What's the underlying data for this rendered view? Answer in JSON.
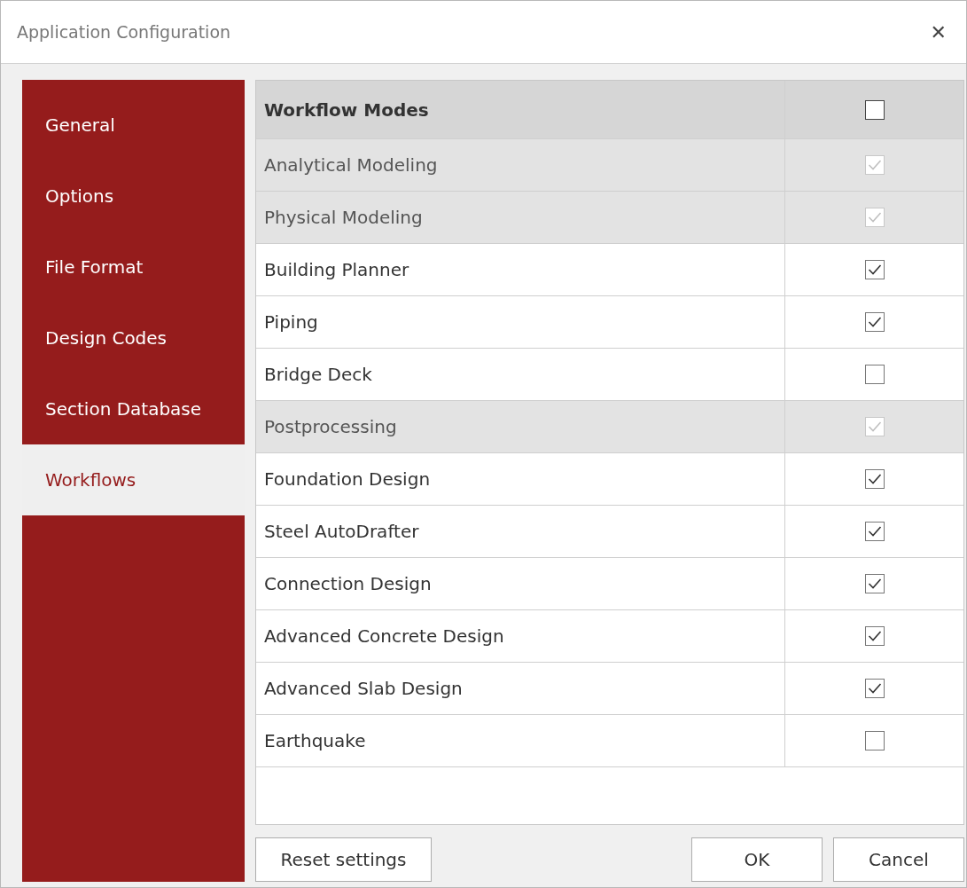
{
  "window": {
    "title": "Application Configuration",
    "close": "✕"
  },
  "sidebar": {
    "items": [
      {
        "label": "General",
        "selected": false
      },
      {
        "label": "Options",
        "selected": false
      },
      {
        "label": "File Format",
        "selected": false
      },
      {
        "label": "Design Codes",
        "selected": false
      },
      {
        "label": "Section Database",
        "selected": false
      },
      {
        "label": "Workflows",
        "selected": true
      }
    ]
  },
  "table": {
    "header": {
      "label": "Workflow Modes",
      "checked": false
    },
    "rows": [
      {
        "label": "Analytical Modeling",
        "checked": true,
        "disabled": true
      },
      {
        "label": "Physical Modeling",
        "checked": true,
        "disabled": true
      },
      {
        "label": "Building Planner",
        "checked": true,
        "disabled": false
      },
      {
        "label": "Piping",
        "checked": true,
        "disabled": false
      },
      {
        "label": "Bridge Deck",
        "checked": false,
        "disabled": false
      },
      {
        "label": "Postprocessing",
        "checked": true,
        "disabled": true
      },
      {
        "label": "Foundation Design",
        "checked": true,
        "disabled": false
      },
      {
        "label": "Steel AutoDrafter",
        "checked": true,
        "disabled": false
      },
      {
        "label": "Connection Design",
        "checked": true,
        "disabled": false
      },
      {
        "label": "Advanced Concrete Design",
        "checked": true,
        "disabled": false
      },
      {
        "label": "Advanced Slab Design",
        "checked": true,
        "disabled": false
      },
      {
        "label": "Earthquake",
        "checked": false,
        "disabled": false
      }
    ]
  },
  "buttons": {
    "reset": "Reset settings",
    "ok": "OK",
    "cancel": "Cancel"
  }
}
